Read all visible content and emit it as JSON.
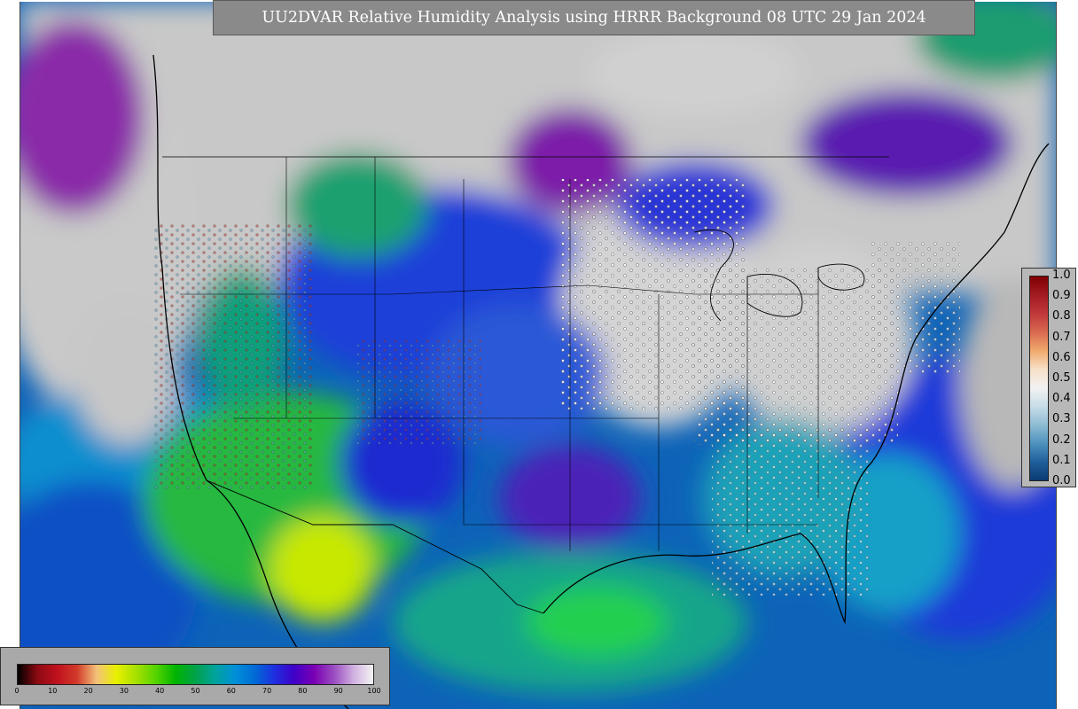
{
  "map": {
    "title": "UU2DVAR Relative Humidity Analysis using HRRR Background 08 UTC 29 Jan 2024"
  },
  "colorbar": {
    "ticks": [
      "1.0",
      "0.9",
      "0.8",
      "0.7",
      "0.6",
      "0.5",
      "0.4",
      "0.3",
      "0.2",
      "0.1",
      "0.0"
    ],
    "colors": [
      "#7f0000",
      "#a31b22",
      "#c0383a",
      "#d9694f",
      "#f0a96b",
      "#f7e0c8",
      "#f2f2f2",
      "#c8dde8",
      "#8fbcd3",
      "#4e92be",
      "#1f5f9c",
      "#0b3b73"
    ]
  },
  "rh_legend": {
    "ticks": [
      "0",
      "10",
      "20",
      "30",
      "40",
      "50",
      "60",
      "70",
      "80",
      "90",
      "100"
    ],
    "colors": [
      "#000000",
      "#8c0a12",
      "#c0111e",
      "#d23a2a",
      "#f3c27a",
      "#e8f000",
      "#a6e000",
      "#55d400",
      "#00b400",
      "#00a24a",
      "#00a39c",
      "#0090d8",
      "#006bd6",
      "#1e2ee0",
      "#4000c8",
      "#7a00b4",
      "#9a4cc0",
      "#d0b0e0",
      "#f4f4f4"
    ]
  }
}
